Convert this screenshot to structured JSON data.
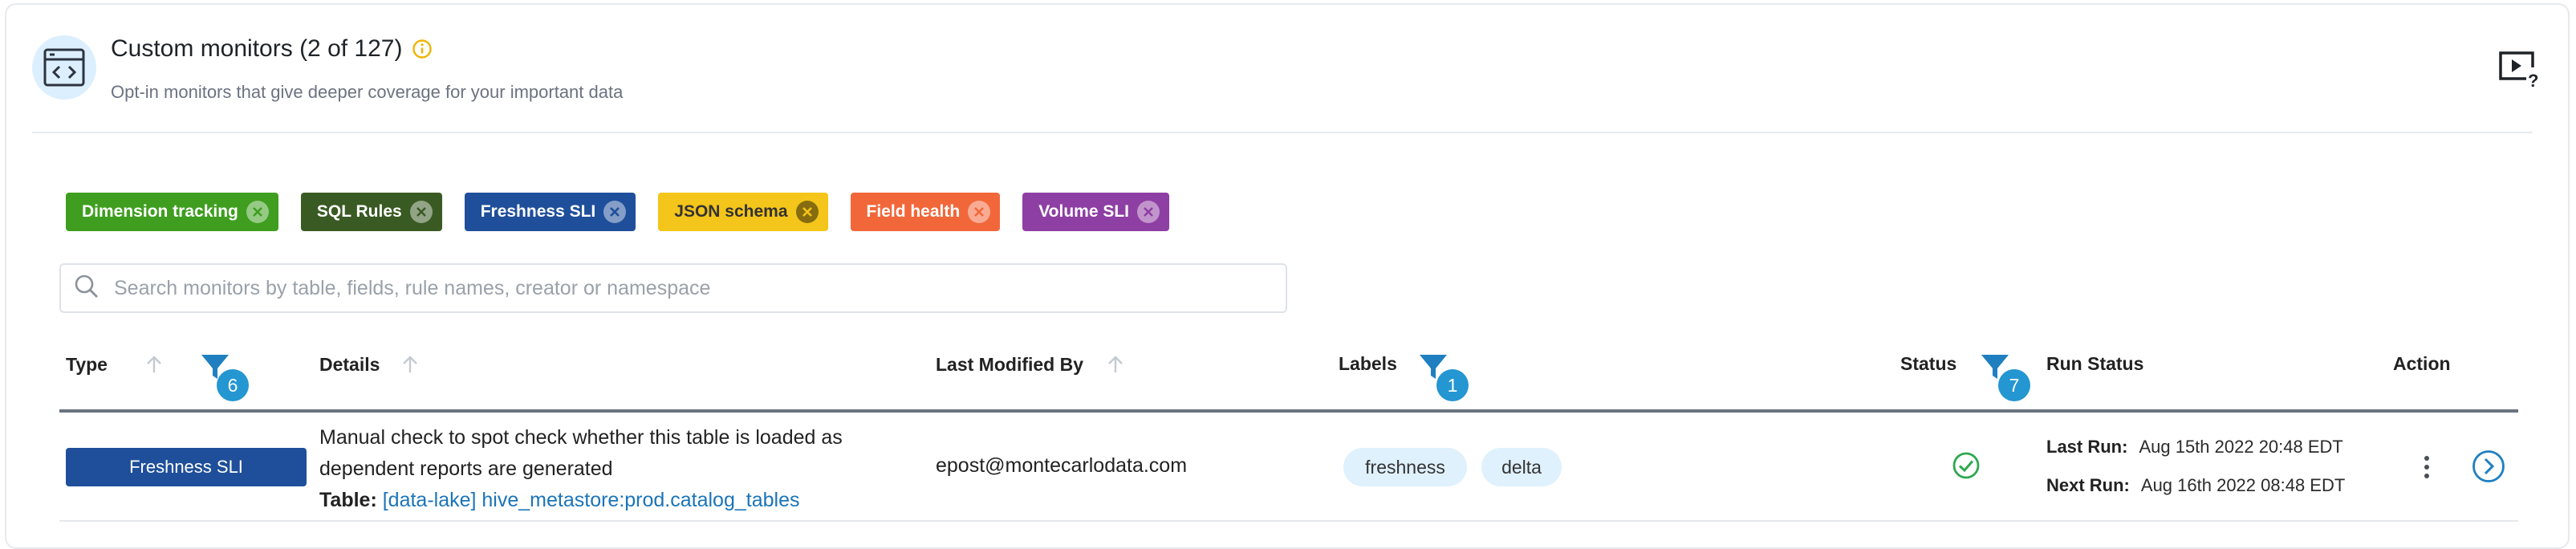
{
  "header": {
    "title": "Custom monitors (2 of 127)",
    "subtitle": "Opt-in monitors that give deeper coverage for your important data"
  },
  "colors": {
    "accent": "#2496d1",
    "info": "#f0b400",
    "status_ok": "#2fa84f",
    "link": "#1b74b8"
  },
  "filter_chips": [
    {
      "label": "Dimension tracking",
      "color": "#3f9e1f"
    },
    {
      "label": "SQL Rules",
      "color": "#3a5a23"
    },
    {
      "label": "Freshness SLI",
      "color": "#1f4f9a"
    },
    {
      "label": "JSON schema",
      "color": "#f4c51a",
      "text_color": "#333333"
    },
    {
      "label": "Field health",
      "color": "#f2673a"
    },
    {
      "label": "Volume SLI",
      "color": "#8e3fa3"
    }
  ],
  "search": {
    "placeholder": "Search monitors by table, fields, rule names, creator or namespace",
    "value": ""
  },
  "table": {
    "columns": {
      "type": "Type",
      "details": "Details",
      "last_modified_by": "Last Modified By",
      "labels": "Labels",
      "status": "Status",
      "run_status": "Run Status",
      "action": "Action"
    },
    "filter_counts": {
      "type": "6",
      "labels": "1",
      "status": "7"
    },
    "rows": [
      {
        "type": "Freshness SLI",
        "details_line1": "Manual check to spot check whether this table is loaded as",
        "details_line2": "dependent reports are generated",
        "table_label": "Table:",
        "table_link": "[data-lake] hive_metastore:prod.catalog_tables",
        "last_modified_by": "epost@montecarlodata.com",
        "labels": [
          "freshness",
          "delta"
        ],
        "status": "ok",
        "last_run_label": "Last Run:",
        "last_run": "Aug 15th 2022 20:48 EDT",
        "next_run_label": "Next Run:",
        "next_run": "Aug 16th 2022 08:48 EDT"
      }
    ]
  }
}
